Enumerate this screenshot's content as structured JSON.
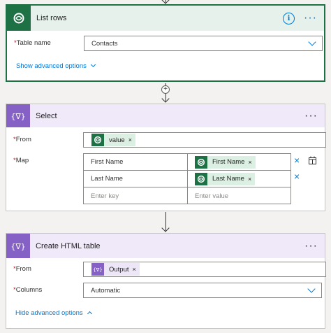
{
  "colors": {
    "dataverse_green": "#1e7145",
    "data_ops_purple": "#8661c5",
    "link_blue": "#0078d4",
    "required_red": "#a4262c"
  },
  "list_rows": {
    "title": "List rows",
    "icon": "dataverse-icon",
    "more_label": "···",
    "info_label": "i",
    "table_name_label": "Table name",
    "table_name_value": "Contacts",
    "advanced_link": "Show advanced options"
  },
  "connector1": {
    "add_label": "+"
  },
  "select": {
    "title": "Select",
    "icon": "data-operation-icon",
    "more_label": "···",
    "from_label": "From",
    "from_token": "value",
    "map_label": "Map",
    "map_rows": [
      {
        "key": "First Name",
        "value_token": "First Name"
      },
      {
        "key": "Last Name",
        "value_token": "Last Name"
      }
    ],
    "key_placeholder": "Enter key",
    "value_placeholder": "Enter value",
    "remove_label": "×"
  },
  "html_table": {
    "title": "Create HTML table",
    "icon": "data-operation-icon",
    "more_label": "···",
    "from_label": "From",
    "from_token": "Output",
    "columns_label": "Columns",
    "columns_value": "Automatic",
    "advanced_link": "Hide advanced options"
  },
  "token_remove": "×",
  "required_mark": "*"
}
